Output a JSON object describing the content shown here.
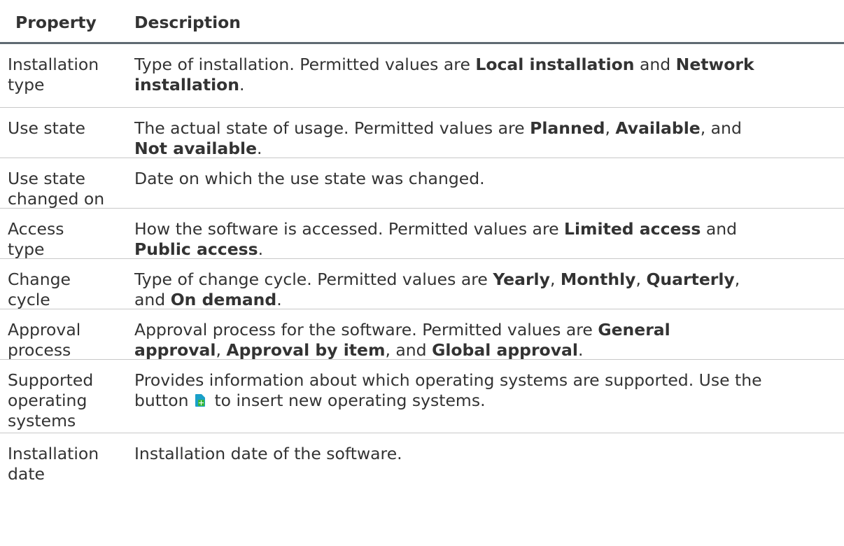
{
  "headers": {
    "property": "Property",
    "description": "Description"
  },
  "rows": [
    {
      "property": [
        "Installation",
        "type"
      ],
      "description": {
        "t0": "Type of installation. Permitted values are ",
        "b0": "Local installation",
        "t1": " and ",
        "b1": "Network",
        "b2": "installation",
        "t2": "."
      }
    },
    {
      "property": [
        "Use state"
      ],
      "description": {
        "t0": "The actual state of usage. Permitted values are ",
        "b0": "Planned",
        "t1": ", ",
        "b1": "Available",
        "t2": ", and",
        "b2": "Not available",
        "t3": "."
      }
    },
    {
      "property": [
        "Use state",
        "changed on"
      ],
      "description": {
        "t0": "Date on which the use state was changed."
      }
    },
    {
      "property": [
        "Access",
        "type"
      ],
      "description": {
        "t0": "How the software is accessed. Permitted values are ",
        "b0": "Limited access",
        "t1": " and",
        "b1": "Public access",
        "t2": "."
      }
    },
    {
      "property": [
        "Change",
        "cycle"
      ],
      "description": {
        "t0": "Type of change cycle. Permitted values are ",
        "b0": "Yearly",
        "t1": ", ",
        "b1": "Monthly",
        "t2": ", ",
        "b2": "Quarterly",
        "t3": ",",
        "t4": "and ",
        "b3": "On demand",
        "t5": "."
      }
    },
    {
      "property": [
        "Approval",
        "process"
      ],
      "description": {
        "t0": "Approval process for the software. Permitted values are ",
        "b0": "General",
        "b1": "approval",
        "t1": ", ",
        "b2": "Approval by item",
        "t2": ", and ",
        "b3": "Global approval",
        "t3": "."
      }
    },
    {
      "property": [
        "Supported",
        "operating",
        "systems"
      ],
      "description": {
        "t0": "Provides information about which operating systems are supported. Use the",
        "t1": "button ",
        "icon": "add-document-icon",
        "t2": " to insert new operating systems."
      }
    },
    {
      "property": [
        "Installation",
        "date"
      ],
      "description": {
        "t0": "Installation date of the software."
      }
    }
  ]
}
